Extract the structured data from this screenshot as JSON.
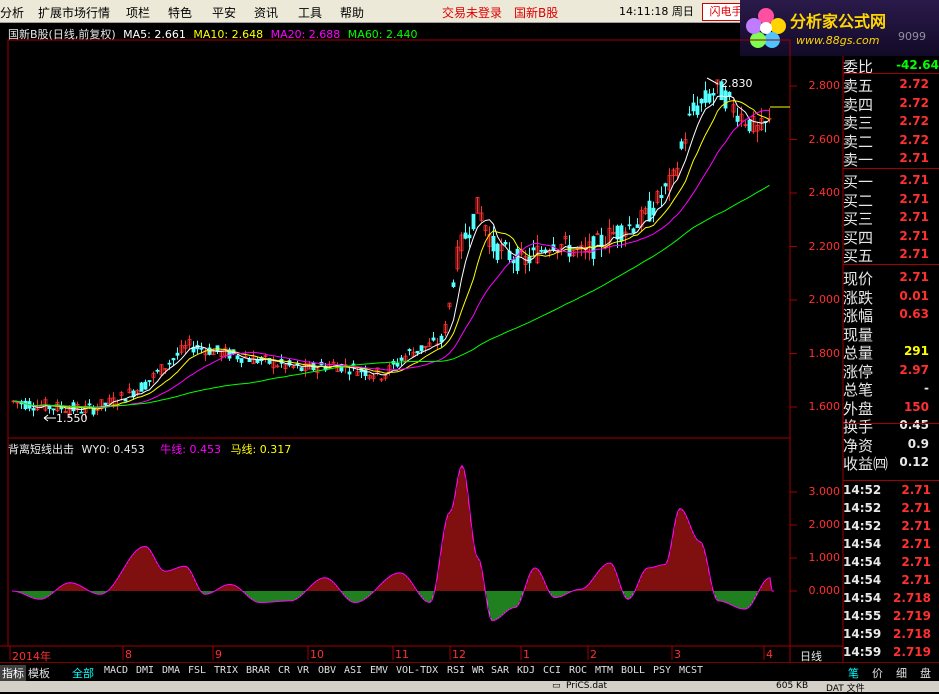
{
  "menu": {
    "items": [
      "分析",
      "扩展市场行情",
      "项栏",
      "特色",
      "平安",
      "资讯",
      "工具",
      "帮助"
    ],
    "status_items": [
      "交易未登录",
      "国新B股"
    ],
    "clock": "14:11:18 周日",
    "flash_button": "闪电手"
  },
  "logo": {
    "title": "分析家公式网",
    "url": "www.88gs.com",
    "partial_code": "9099"
  },
  "kline": {
    "stock_title": "国新B股(日线,前复权)",
    "ma5_label": "MA5: 2.661",
    "ma10_label": "MA10: 2.648",
    "ma20_label": "MA20: 2.688",
    "ma60_label": "MA60: 2.440",
    "high_marker": "2.830",
    "low_marker": "1.550",
    "y_ticks": [
      "2.800",
      "2.600",
      "2.400",
      "2.200",
      "2.000",
      "1.800",
      "1.600"
    ],
    "colors": {
      "up": "#ff3030",
      "down": "#54ffff",
      "ma5": "#ffffff",
      "ma10": "#ffff00",
      "ma20": "#ff00ff",
      "ma60": "#00ff00"
    }
  },
  "indicator": {
    "name": "背离短线出击",
    "wy0_label": "WY0: 0.453",
    "niu_label": "牛线: 0.453",
    "ma_label": "马线: 0.317",
    "y_ticks": [
      "3.000",
      "2.000",
      "1.000",
      "0.000"
    ]
  },
  "x_axis": {
    "labels": [
      "2014年",
      "8",
      "9",
      "10",
      "11",
      "12",
      "1",
      "2",
      "3",
      "4"
    ],
    "period": "日线"
  },
  "quote": {
    "ratio_label": "委比",
    "ratio_value": "-42.64",
    "sells": [
      {
        "label": "卖五",
        "value": "2.72"
      },
      {
        "label": "卖四",
        "value": "2.72"
      },
      {
        "label": "卖三",
        "value": "2.72"
      },
      {
        "label": "卖二",
        "value": "2.72"
      },
      {
        "label": "卖一",
        "value": "2.71"
      }
    ],
    "buys": [
      {
        "label": "买一",
        "value": "2.71"
      },
      {
        "label": "买二",
        "value": "2.71"
      },
      {
        "label": "买三",
        "value": "2.71"
      },
      {
        "label": "买四",
        "value": "2.71"
      },
      {
        "label": "买五",
        "value": "2.71"
      }
    ],
    "stats": [
      {
        "label": "现价",
        "value": "2.71",
        "color": "#ff3030"
      },
      {
        "label": "涨跌",
        "value": "0.01",
        "color": "#ff3030"
      },
      {
        "label": "涨幅",
        "value": "0.63",
        "color": "#ff3030"
      },
      {
        "label": "现量",
        "value": "",
        "color": "#ffff00"
      },
      {
        "label": "总量",
        "value": "291",
        "color": "#ffff00"
      },
      {
        "label": "涨停",
        "value": "2.97",
        "color": "#ff3030"
      },
      {
        "label": "总笔",
        "value": "-",
        "color": "#e8e8e8"
      },
      {
        "label": "外盘",
        "value": "150",
        "color": "#ff3030"
      },
      {
        "label": "换手",
        "value": "0.45",
        "color": "#e8e8e8"
      },
      {
        "label": "净资",
        "value": "0.9",
        "color": "#e8e8e8"
      },
      {
        "label": "收益㈣",
        "value": "0.12",
        "color": "#e8e8e8"
      }
    ],
    "ticks": [
      {
        "time": "14:52",
        "price": "2.71"
      },
      {
        "time": "14:52",
        "price": "2.71"
      },
      {
        "time": "14:52",
        "price": "2.71"
      },
      {
        "time": "14:54",
        "price": "2.71"
      },
      {
        "time": "14:54",
        "price": "2.71"
      },
      {
        "time": "14:54",
        "price": "2.71"
      },
      {
        "time": "14:54",
        "price": "2.718"
      },
      {
        "time": "14:55",
        "price": "2.719"
      },
      {
        "time": "14:59",
        "price": "2.718"
      },
      {
        "time": "14:59",
        "price": "2.719"
      }
    ]
  },
  "bottom_tabs": [
    "指标",
    "模板",
    "全部",
    "MACD",
    "DMI",
    "DMA",
    "FSL",
    "TRIX",
    "BRAR",
    "CR",
    "VR",
    "OBV",
    "ASI",
    "EMV",
    "VOL-TDX",
    "RSI",
    "WR",
    "SAR",
    "KDJ",
    "CCI",
    "ROC",
    "MTM",
    "BOLL",
    "PSY",
    "MCST"
  ],
  "right_tabs": [
    "笔",
    "价",
    "细",
    "盘"
  ],
  "status_bar": {
    "file": "PriCS.dat",
    "size": "605 KB",
    "type": "DAT 文件"
  }
}
